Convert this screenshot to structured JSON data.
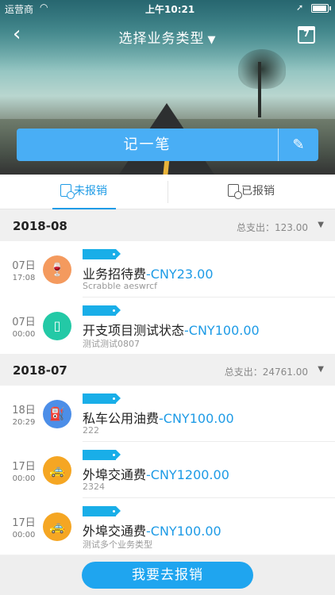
{
  "status_bar": {
    "carrier": "运营商",
    "time": "上午10:21"
  },
  "nav": {
    "title": "选择业务类型",
    "caret": "▼",
    "back": "‹",
    "calendar_day": "7"
  },
  "record": {
    "label": "记一笔",
    "edit_icon": "pencil-icon"
  },
  "tabs": [
    {
      "label": "未报销",
      "active": true
    },
    {
      "label": "已报销",
      "active": false
    }
  ],
  "groups": [
    {
      "month": "2018-08",
      "total_label": "总支出：",
      "total_value": "123.00",
      "items": [
        {
          "day": "07日",
          "time": "17:08",
          "category": "业务招待费",
          "amount": "-CNY23.00",
          "note": "Scrabble aeswrcf",
          "icon": "wine-glass-icon",
          "color": "#f49a5e"
        },
        {
          "day": "07日",
          "time": "00:00",
          "category": "开支项目测试状态",
          "amount": "-CNY100.00",
          "note": "测试测试0807",
          "icon": "phone-icon",
          "color": "#23c9a6"
        }
      ]
    },
    {
      "month": "2018-07",
      "total_label": "总支出：",
      "total_value": "24761.00",
      "items": [
        {
          "day": "18日",
          "time": "20:29",
          "category": "私车公用油费",
          "amount": "-CNY100.00",
          "note": "222",
          "icon": "fuel-pump-icon",
          "color": "#4c8ee8"
        },
        {
          "day": "17日",
          "time": "00:00",
          "category": "外埠交通费",
          "amount": "-CNY1200.00",
          "note": "2324",
          "icon": "car-icon",
          "color": "#f5a623"
        },
        {
          "day": "17日",
          "time": "00:00",
          "category": "外埠交通费",
          "amount": "-CNY100.00",
          "note": "测试多个业务类型",
          "icon": "car-icon",
          "color": "#f5a623"
        }
      ]
    }
  ],
  "submit": {
    "label": "我要去报销"
  }
}
